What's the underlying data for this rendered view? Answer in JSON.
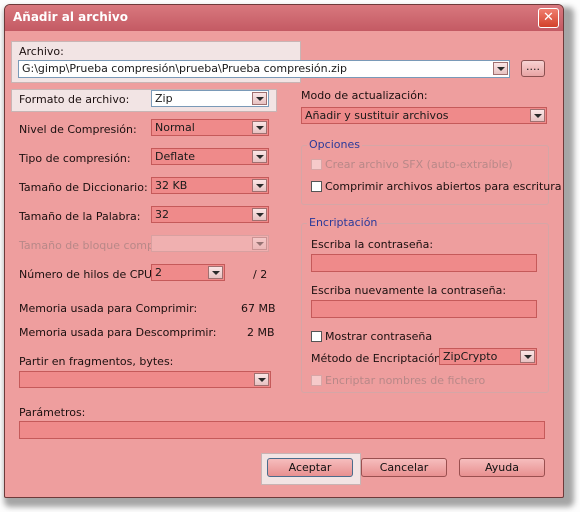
{
  "window": {
    "title": "Añadir al archivo",
    "close_icon": "close-icon",
    "accent_color": "#c45a64",
    "background_color": "#ee9e9e"
  },
  "archive": {
    "label": "Archivo:",
    "value": "G:\\gimp\\Prueba compresión\\prueba\\Prueba compresión.zip",
    "browse_label": "...."
  },
  "left": {
    "format_label": "Formato de archivo:",
    "format_value": "Zip",
    "level_label": "Nivel de Compresión:",
    "level_value": "Normal",
    "type_label": "Tipo de compresión:",
    "type_value": "Deflate",
    "dict_label": "Tamaño de Diccionario:",
    "dict_value": "32 KB",
    "word_label": "Tamaño de la Palabra:",
    "word_value": "32",
    "block_label": "Tamaño de bloque compacto:",
    "block_value": "",
    "threads_label": "Número de hilos de CPU:",
    "threads_value": "2",
    "threads_max": "/ 2",
    "mem_compress_label": "Memoria usada para Comprimir:",
    "mem_compress_value": "67 MB",
    "mem_decompress_label": "Memoria usada para Descomprimir:",
    "mem_decompress_value": "2 MB",
    "split_label": "Partir en fragmentos, bytes:",
    "split_value": "",
    "params_label": "Parámetros:",
    "params_value": ""
  },
  "right": {
    "update_label": "Modo de actualización:",
    "update_value": "Añadir y sustituir archivos",
    "options_title": "Opciones",
    "sfx_label": "Crear archivo SFX (auto-extraíble)",
    "open_files_label": "Comprimir archivos abiertos para escritura",
    "encryption_title": "Encriptación",
    "password_label": "Escriba la contraseña:",
    "password_value": "",
    "password_again_label": "Escriba nuevamente la contraseña:",
    "password_again_value": "",
    "show_password_label": "Mostrar contraseña",
    "method_label": "Método de Encriptación:",
    "method_value": "ZipCrypto",
    "encrypt_names_label": "Encriptar nombres de fichero"
  },
  "buttons": {
    "ok": "Aceptar",
    "cancel": "Cancelar",
    "help": "Ayuda"
  }
}
